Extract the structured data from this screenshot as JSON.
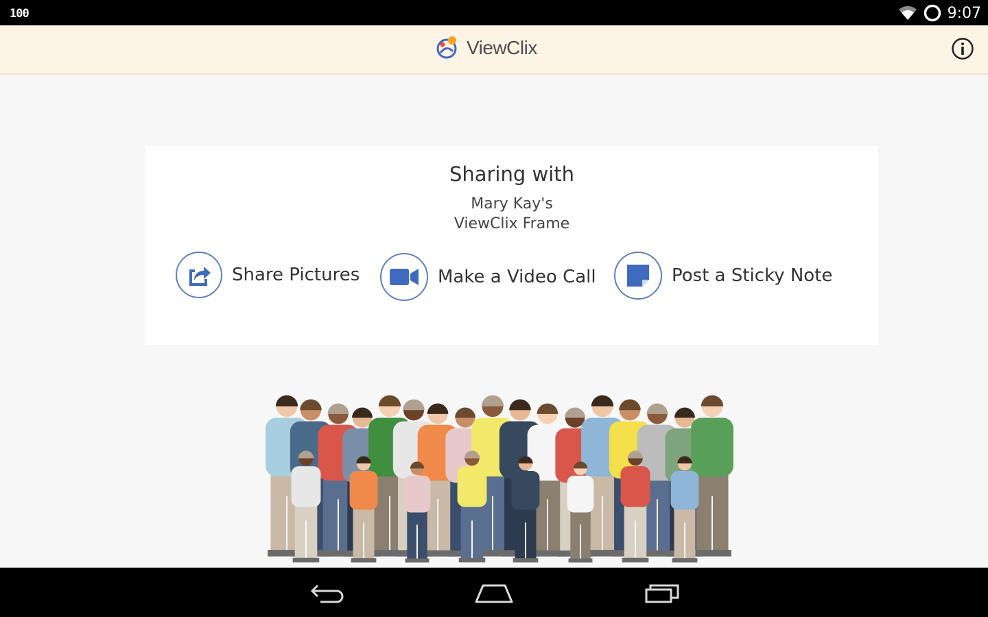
{
  "status_bar": {
    "battery": "100",
    "time": "9:07"
  },
  "app_bar": {
    "brand_name": "ViewClix"
  },
  "card": {
    "title": "Sharing with",
    "recipient_line1": "Mary Kay's",
    "recipient_line2": "ViewClix Frame",
    "actions": [
      {
        "label": "Share Pictures",
        "icon": "share-icon"
      },
      {
        "label": "Make a Video Call",
        "icon": "video-camera-icon"
      },
      {
        "label": "Post a Sticky Note",
        "icon": "sticky-note-icon"
      }
    ]
  },
  "colors": {
    "app_bar_bg": "#fcf4e5",
    "accent_blue": "#3f6bbf",
    "icon_ring": "#5f7fbf"
  }
}
